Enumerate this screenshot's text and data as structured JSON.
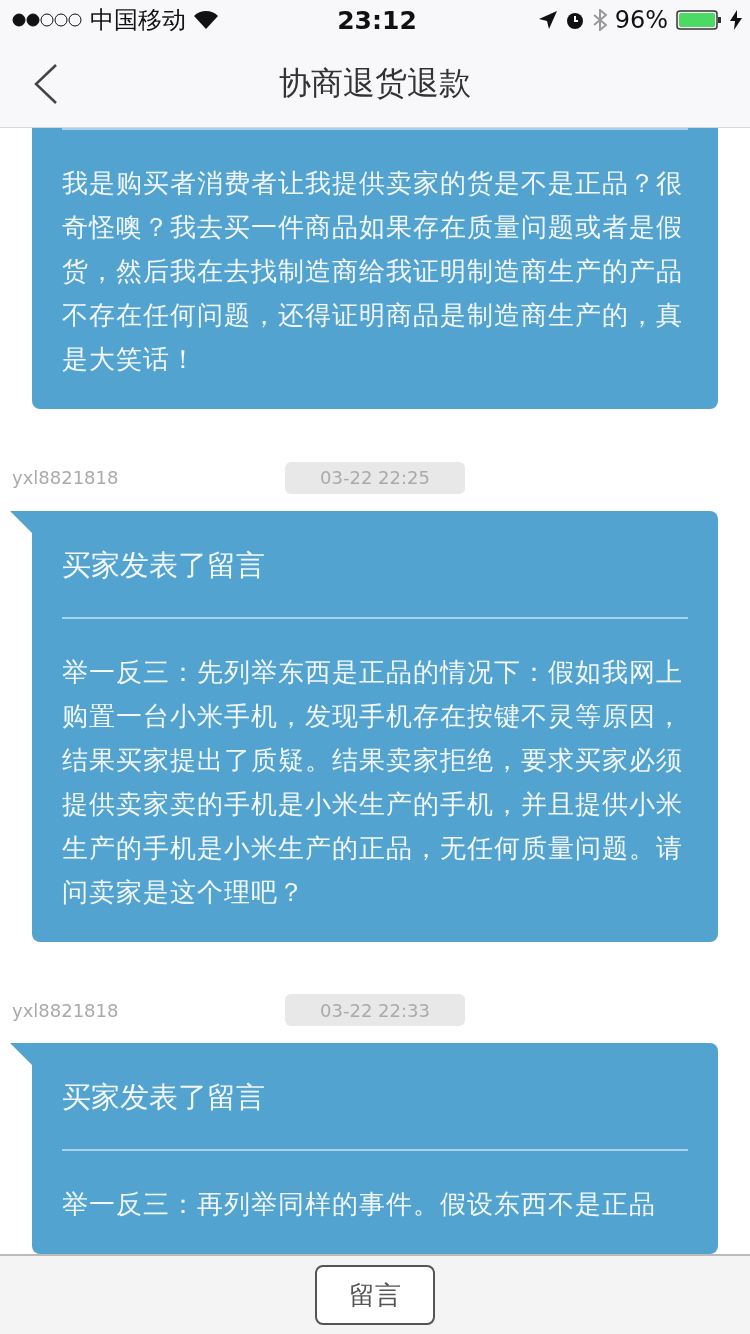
{
  "status_bar": {
    "carrier": "中国移动",
    "time": "23:12",
    "battery": "96%"
  },
  "nav_bar": {
    "title": "协商退货退款"
  },
  "messages": [
    {
      "text": "我是购买者消费者让我提供卖家的货是不是正品？很奇怪噢？我去买一件商品如果存在质量问题或者是假货，然后我在去找制造商给我证明制造商生产的产品不存在任何问题，还得证明商品是制造商生产的，真是大笑话！"
    },
    {
      "author": "yxl8821818",
      "time": "03-22 22:25",
      "title": "买家发表了留言",
      "text": "举一反三：先列举东西是正品的情况下：假如我网上购置一台小米手机，发现手机存在按键不灵等原因，结果买家提出了质疑。结果卖家拒绝，要求买家必须提供卖家卖的手机是小米生产的手机，并且提供小米生产的手机是小米生产的正品，无任何质量问题。请问卖家是这个理吧？"
    },
    {
      "author": "yxl8821818",
      "time": "03-22 22:33",
      "title": "买家发表了留言",
      "text": "举一反三：再列举同样的事件。假设东西不是正品"
    }
  ],
  "bottom_bar": {
    "button": "留言"
  }
}
